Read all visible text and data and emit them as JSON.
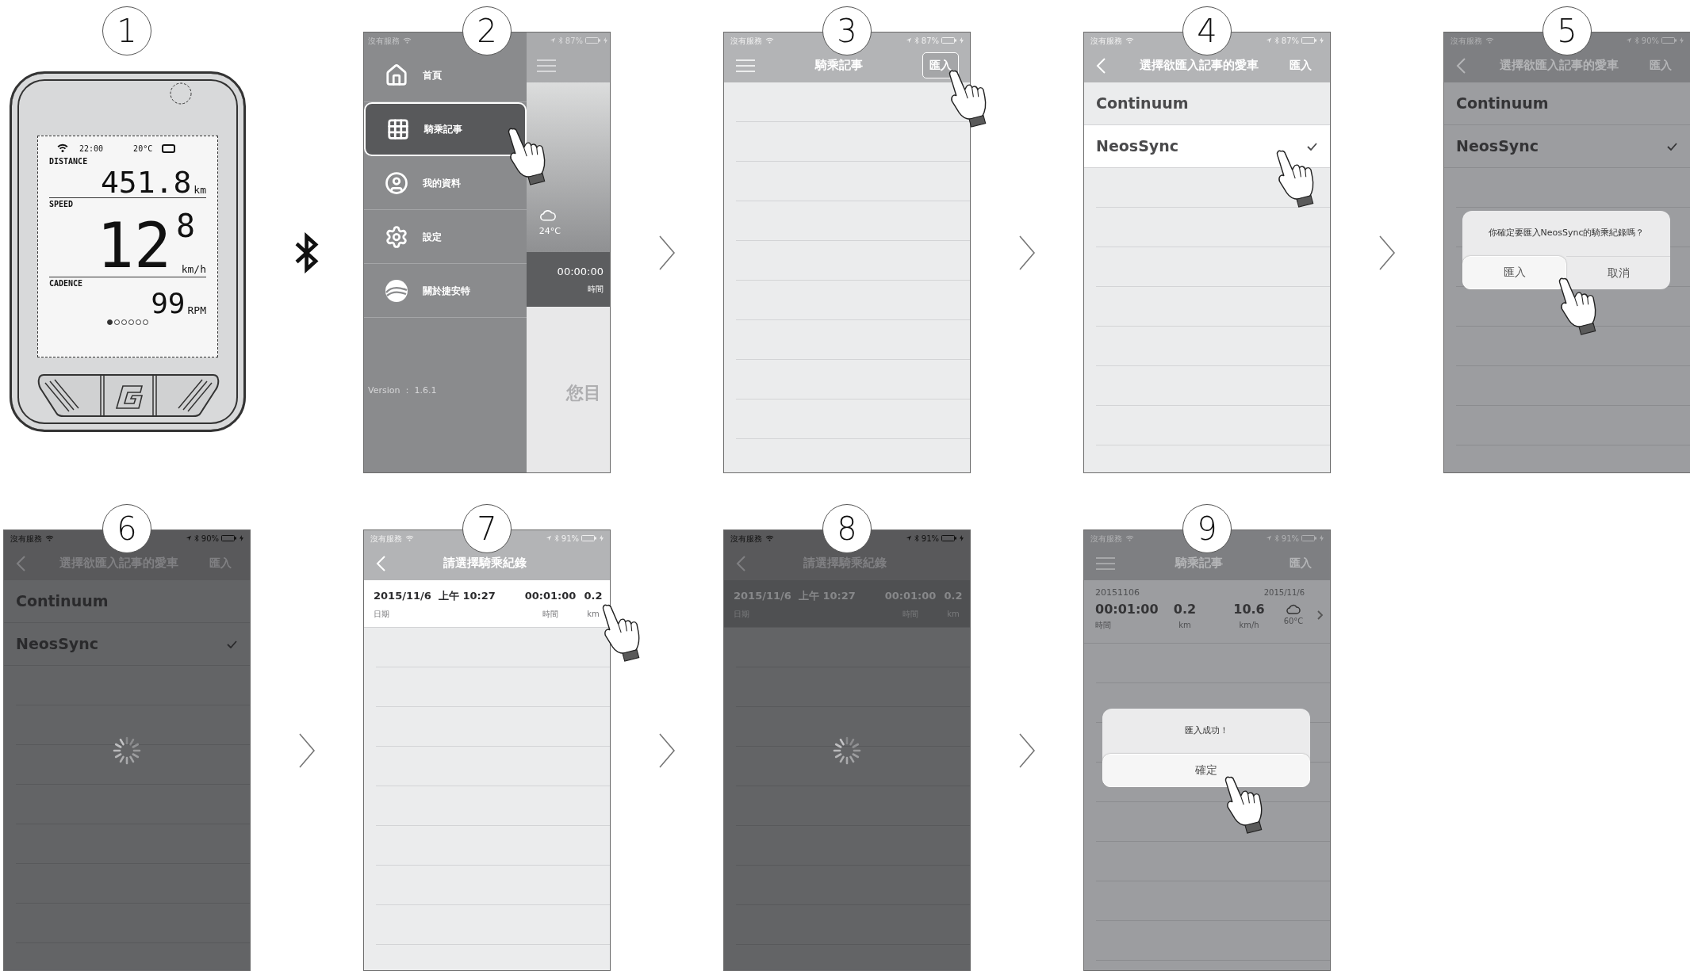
{
  "steps": [
    {
      "number": "1",
      "kind": "device",
      "connector": {
        "kind": "bluetooth"
      },
      "device": {
        "time": "22:00",
        "temperature": "20°C",
        "distance": {
          "label": "DISTANCE",
          "value": "451.8",
          "unit": "km"
        },
        "speed": {
          "label": "SPEED",
          "value": "12",
          "decimal": "8",
          "unit": "km/h"
        },
        "cadence": {
          "label": "CADENCE",
          "value": "99",
          "unit": "RPM"
        },
        "pages": [
          {
            "selected": true
          },
          {
            "selected": false
          },
          {
            "selected": false
          },
          {
            "selected": false
          },
          {
            "selected": false
          },
          {
            "selected": false
          }
        ]
      }
    },
    {
      "number": "2",
      "kind": "menu",
      "connector": {
        "kind": "arrow"
      },
      "status": {
        "carrier": "沒有服務",
        "battery": "87%"
      },
      "menu": {
        "items": [
          {
            "label": "首頁",
            "selected": false,
            "tapped": false
          },
          {
            "label": "騎乘記事",
            "selected": true,
            "tapped": true
          },
          {
            "label": "我的資料",
            "selected": false,
            "tapped": false
          },
          {
            "label": "設定",
            "selected": false,
            "tapped": false
          },
          {
            "label": "關於捷安特",
            "selected": false,
            "tapped": false
          }
        ],
        "version": "Version ： 1.6.1"
      },
      "dashboard": {
        "temperature": "24°C",
        "time": "00:00:00",
        "time_label": "時間",
        "message": "您目"
      }
    },
    {
      "number": "3",
      "kind": "list",
      "dimmed": false,
      "connector": {
        "kind": "arrow"
      },
      "status": {
        "carrier": "沒有服務",
        "battery": "87%"
      },
      "header": {
        "back_button": false,
        "title": "騎乘記事",
        "action": {
          "label": "匯入",
          "tapped": true
        }
      }
    },
    {
      "number": "4",
      "kind": "list",
      "dimmed": false,
      "connector": {
        "kind": "arrow"
      },
      "status": {
        "carrier": "沒有服務",
        "battery": "87%"
      },
      "header": {
        "back_button": true,
        "title": "選擇欲匯入記事的愛車",
        "action": {
          "label": "匯入",
          "tapped": false
        }
      },
      "rows": [
        {
          "kind": "option",
          "label": "Continuum",
          "checked": false,
          "selected": false,
          "tapped": false
        },
        {
          "kind": "option",
          "label": "NeosSync",
          "checked": true,
          "selected": true,
          "tapped": true
        }
      ]
    },
    {
      "number": "5",
      "kind": "list",
      "dimmed": true,
      "status": {
        "carrier": "沒有服務",
        "battery": "90%"
      },
      "header": {
        "back_button": true,
        "title": "選擇欲匯入記事的愛車",
        "action": {
          "label": "匯入",
          "tapped": false
        }
      },
      "rows": [
        {
          "kind": "option",
          "label": "Continuum",
          "checked": false,
          "selected": false,
          "tapped": false
        },
        {
          "kind": "option",
          "label": "NeosSync",
          "checked": true,
          "selected": false,
          "tapped": false
        }
      ],
      "dialog": {
        "message": "你確定要匯入NeosSync的騎乘紀錄嗎？",
        "buttons": [
          {
            "label": "匯入",
            "tapped": true
          },
          {
            "label": "取消",
            "tapped": false
          }
        ]
      }
    },
    {
      "number": "6",
      "kind": "list",
      "dimmed": true,
      "connector": {
        "kind": "arrow"
      },
      "loading": true,
      "status": {
        "carrier": "沒有服務",
        "battery": "90%"
      },
      "header": {
        "back_button": true,
        "title": "選擇欲匯入記事的愛車",
        "action": {
          "label": "匯入",
          "tapped": false
        }
      },
      "rows": [
        {
          "kind": "option",
          "label": "Continuum",
          "checked": false,
          "selected": false,
          "tapped": false
        },
        {
          "kind": "option",
          "label": "NeosSync",
          "checked": true,
          "selected": false,
          "tapped": false
        }
      ]
    },
    {
      "number": "7",
      "kind": "list",
      "dimmed": false,
      "connector": {
        "kind": "arrow"
      },
      "status": {
        "carrier": "沒有服務",
        "battery": "91%"
      },
      "header": {
        "back_button": true,
        "title": "請選擇騎乘紀錄"
      },
      "rows": [
        {
          "kind": "record",
          "date": "2015/11/6  上午 10:27",
          "date_label": "日期",
          "time": "00:01:00",
          "time_label": "時間",
          "distance": "0.2",
          "distance_label": "km",
          "tapped": true
        }
      ]
    },
    {
      "number": "8",
      "kind": "list",
      "dimmed": true,
      "connector": {
        "kind": "arrow"
      },
      "loading": true,
      "status": {
        "carrier": "沒有服務",
        "battery": "91%"
      },
      "header": {
        "back_button": true,
        "title": "請選擇騎乘紀錄"
      },
      "rows": [
        {
          "kind": "record",
          "date": "2015/11/6  上午 10:27",
          "date_label": "日期",
          "time": "00:01:00",
          "time_label": "時間",
          "distance": "0.2",
          "distance_label": "km",
          "tapped": false
        }
      ]
    },
    {
      "number": "9",
      "kind": "list",
      "dimmed": true,
      "status": {
        "carrier": "沒有服務",
        "battery": "91%"
      },
      "header": {
        "back_button": false,
        "title": "騎乘記事",
        "action": {
          "label": "匯入",
          "tapped": false
        }
      },
      "rows": [
        {
          "kind": "summary",
          "id": "20151106",
          "date": "2015/11/6",
          "time": "00:01:00",
          "time_label": "時間",
          "distance": "0.2",
          "distance_label": "km",
          "speed": "10.6",
          "speed_label": "km/h",
          "temperature": "60°C"
        }
      ],
      "dialog": {
        "message": "匯入成功！",
        "buttons": [
          {
            "label": "確定",
            "tapped": true
          }
        ]
      }
    }
  ]
}
